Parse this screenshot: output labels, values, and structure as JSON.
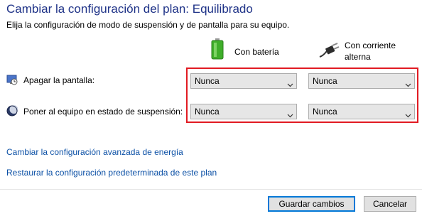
{
  "header": {
    "title": "Cambiar la configuración del plan: Equilibrado",
    "subtitle": "Elija la configuración de modo de suspensión y de pantalla para su equipo."
  },
  "columns": {
    "battery_label": "Con batería",
    "ac_label_line1": "Con corriente",
    "ac_label_line2": "alterna"
  },
  "rows": {
    "display": {
      "label": "Apagar la pantalla:",
      "battery_value": "Nunca",
      "ac_value": "Nunca"
    },
    "sleep": {
      "label": "Poner al equipo en estado de suspensión:",
      "battery_value": "Nunca",
      "ac_value": "Nunca"
    }
  },
  "links": {
    "advanced": "Cambiar la configuración avanzada de energía",
    "restore": "Restaurar la configuración predeterminada de este plan"
  },
  "buttons": {
    "save": "Guardar cambios",
    "cancel": "Cancelar"
  },
  "icons": {
    "battery": "battery-icon",
    "plug": "power-plug-icon",
    "display": "display-timer-icon",
    "sleep": "moon-sleep-icon",
    "chevron": "chevron-down-icon"
  },
  "colors": {
    "title": "#1e3287",
    "link": "#0a4fa5",
    "highlight_frame": "#e11b22",
    "battery_green": "#3fae2a",
    "default_button_border": "#0078d7"
  }
}
